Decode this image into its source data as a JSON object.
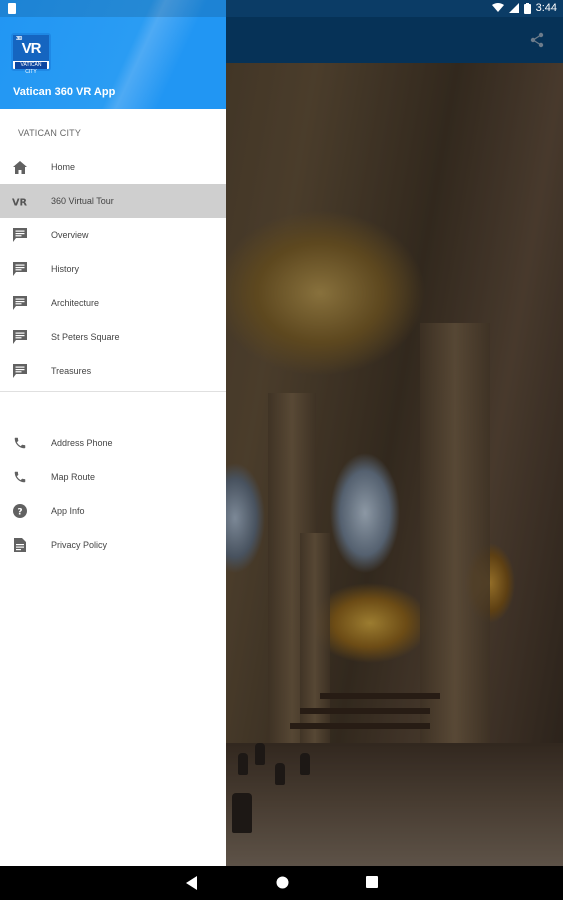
{
  "status_bar": {
    "time": "3:44"
  },
  "drawer": {
    "app_title": "Vatican 360 VR App",
    "logo": {
      "text": "VR",
      "small": "360",
      "caption": "VATICAN CITY"
    },
    "section_label": "VATICAN CITY",
    "primary_items": [
      {
        "label": "Home",
        "icon": "home-icon"
      },
      {
        "label": "360 Virtual Tour",
        "icon": "vr-icon",
        "active": true
      },
      {
        "label": "Overview",
        "icon": "comment-icon"
      },
      {
        "label": "History",
        "icon": "comment-icon"
      },
      {
        "label": "Architecture",
        "icon": "comment-icon"
      },
      {
        "label": "St Peters Square",
        "icon": "comment-icon"
      },
      {
        "label": "Treasures",
        "icon": "comment-icon"
      }
    ],
    "secondary_items": [
      {
        "label": "Address Phone",
        "icon": "phone-icon"
      },
      {
        "label": "Map Route",
        "icon": "phone-icon"
      },
      {
        "label": "App Info",
        "icon": "help-icon"
      },
      {
        "label": "Privacy Policy",
        "icon": "document-icon"
      }
    ]
  },
  "colors": {
    "header_blue": "#2196f3",
    "app_bar": "#0a4a80",
    "active_item": "#cfcfcf"
  }
}
